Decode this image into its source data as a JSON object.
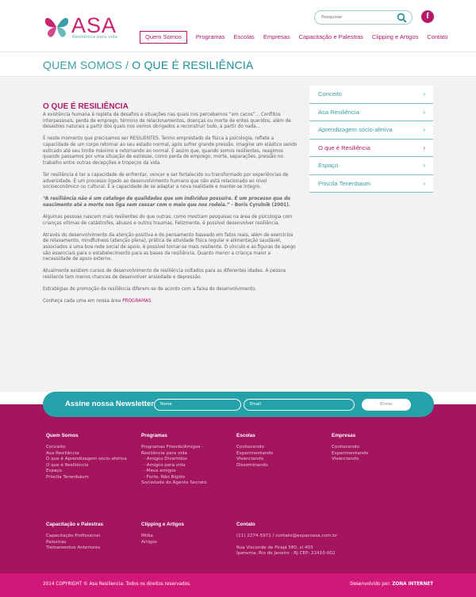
{
  "brand": {
    "name": "ASA",
    "tagline": "Resiliência para vida"
  },
  "search": {
    "placeholder": "Pesquisar"
  },
  "social": {
    "facebook": "f"
  },
  "nav": [
    "Quem Somos",
    "Programas",
    "Escolas",
    "Empresas",
    "Capacitação e Palestras",
    "Clipping e Artigos",
    "Contato"
  ],
  "breadcrumb": {
    "section": "QUEM SOMOS /",
    "page": "O QUE É RESILIÊNCIA"
  },
  "article": {
    "heading": "O QUE É RESILIÊNCIA",
    "p1": "A existência humana é repleta de desafios e situações nas quais nos percebemos “em cacos”... Conflitos interpessoais, perda de emprego, término de relacionamentos, doenças ou morte de entes queridos, além de desastres naturais a partir dos quais nos vemos obrigados a reconstruir tudo, a partir do nada...",
    "p2": "É neste momento que precisamos ser RESILIENTES. Termo emprestado da física à psicologia, reflete a capacidade de um corpo retornar ao seu estado normal, após sofrer grande pressão. Imagine um elástico sendo esticado até seu limite máximo e retornando ao normal. É assim que, quando somos resilientes, reagimos quando passamos por uma situação de estresse, como perda de emprego, morte, separações, pressão no trabalho entre outras decepções e tropeços da vida.",
    "p3": "Ter resiliência é ter a capacidade de enfrentar, vencer e ser fortalecido ou transformado por experiências de adversidade. É um processo ligado ao desenvolvimento humano que não está relacionado ao nível socioeconômico ou cultural. É a capacidade de se adaptar a nova realidade e manter-se íntegro.",
    "quote": "“A resiliência não é um catalogo de qualidades que um indivíduo possuíra. É um processo que do nascimento até a morte nos liga sem cessar com o meio que nos rodeia.”",
    "quote_author": "- Boris Cyrulnik (2001).",
    "p4": "Algumas pessoas nascem mais resilientes do que outras, como mostram pesquisas na área de psicologia com crianças vítimas de catástrofes, abusos e outros traumas. Felizmente, é possível desenvolver resiliência.",
    "p5": "Através do desenvolvimento da atenção positiva e do pensamento baseado em fatos reais, além de exercícios de relaxamento, mindfulness (atenção plena), prática de atividade física regular e alimentação saudável, associados a uma boa rede social de apoio, é possível tornar-se mais resiliente. O vínculo e as figuras de apego são essenciais para o estabelecimento para as bases da resiliência. Quanto menor a criança maior a necessidade de apoio externo.",
    "p6": "Atualmente existem cursos de desenvolvimento de resiliência voltados para as diferentes idades. A pessoa resiliente tem menos chances de desenvolver ansiedade e depressão.",
    "p7": "Estratégias de promoção de resiliência diferem-se de acordo com a faixa do desenvolvimento.",
    "p8_text": "Conheça cada uma em nossa área",
    "p8_link": "PROGRAMAS"
  },
  "sidebar": {
    "items": [
      {
        "label": "Conceito",
        "chevron": "›"
      },
      {
        "label": "Asa Resiliência",
        "chevron": "›"
      },
      {
        "label": "Aprendizagem sócio-afetiva",
        "chevron": "›"
      },
      {
        "label": "O que é Resiliência",
        "chevron": "›"
      },
      {
        "label": "Espaço",
        "chevron": "›"
      },
      {
        "label": "Priscila Tenenbaum",
        "chevron": "›"
      }
    ]
  },
  "newsletter": {
    "title": "Assine nossa Newsletter",
    "name_placeholder": "Nome",
    "email_placeholder": "Email",
    "button": "Enviar"
  },
  "footer": {
    "quem_somos": {
      "title": "Quem Somos",
      "links": [
        "Conceito",
        "Asa Resiliência",
        "O que é Aprendizagem sócio-afetiva",
        "O que é Resiliência",
        "Espaço",
        "Priscila Tenenbaum"
      ]
    },
    "programas": {
      "title": "Programas",
      "links": [
        "Programas Friends/Amigos -",
        "Resiliência para vida",
        "- Amigos Divertidos",
        "- Amigos para vida",
        "- Meus amigos",
        "- Forte, Não Rígido",
        "Sociedade do Agente Secreto"
      ]
    },
    "escolas": {
      "title": "Escolas",
      "links": [
        "Conhecendo",
        "Experimentando",
        "Vivenciando",
        "Disseminando"
      ]
    },
    "empresas": {
      "title": "Empresas",
      "links": [
        "Conhecendo",
        "Experimentando",
        "Vivenciando"
      ]
    },
    "capacitacao": {
      "title": "Capacitação e Palestras",
      "links": [
        "Capacitação Profissional",
        "Palestras",
        "Treinamentos Anteriores"
      ]
    },
    "clipping": {
      "title": "Clipping e Artigos",
      "links": [
        "Mídia",
        "Artigos"
      ]
    },
    "contato": {
      "title": "Contato",
      "phone": "(21) 2274-5971  /  contato@espacoasa.com.br",
      "address1": "Rua Visconde de Pirajá 580, sl 403",
      "address2": "Ipanema, Rio de Janeiro - RJ CEP: 22410-002"
    }
  },
  "bottom": {
    "copyright": "2014 COPYRIGHT © Asa Resiliencia. Todos os direitos reservados.",
    "dev_label": "Desenvolvido por:",
    "dev_name": "ZONA INTERNET"
  },
  "colors": {
    "magenta": "#b1196b",
    "teal": "#25a1aa",
    "footer": "#a3155e",
    "bottom": "#d2177a"
  }
}
